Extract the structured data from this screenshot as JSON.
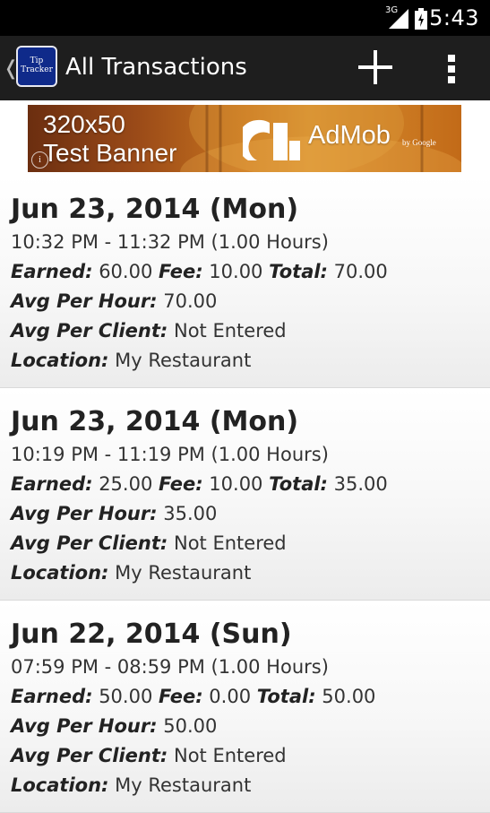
{
  "status_bar": {
    "network_label": "3G",
    "time": "5:43"
  },
  "action_bar": {
    "title": "All Transactions",
    "app_icon_text": [
      "Tip",
      "Tracker"
    ],
    "add_icon": "plus-icon",
    "overflow_icon": "overflow-menu-icon"
  },
  "ad_banner": {
    "line1": "320x50",
    "line2": "Test Banner",
    "brand": "AdMob",
    "by": "by Google"
  },
  "labels": {
    "earned": "Earned:",
    "fee": "Fee:",
    "total": "Total:",
    "avg_per_hour": "Avg Per Hour:",
    "avg_per_client": "Avg Per Client:",
    "location": "Location:"
  },
  "transactions": [
    {
      "date": "Jun 23, 2014 (Mon)",
      "time_range": "10:32 PM - 11:32 PM (1.00 Hours)",
      "earned": "60.00",
      "fee": "10.00",
      "total": "70.00",
      "avg_per_hour": "70.00",
      "avg_per_client": "Not Entered",
      "location": "My Restaurant"
    },
    {
      "date": "Jun 23, 2014 (Mon)",
      "time_range": "10:19 PM - 11:19 PM (1.00 Hours)",
      "earned": "25.00",
      "fee": "10.00",
      "total": "35.00",
      "avg_per_hour": "35.00",
      "avg_per_client": "Not Entered",
      "location": "My Restaurant"
    },
    {
      "date": "Jun 22, 2014 (Sun)",
      "time_range": "07:59 PM - 08:59 PM (1.00 Hours)",
      "earned": "50.00",
      "fee": "0.00",
      "total": "50.00",
      "avg_per_hour": "50.00",
      "avg_per_client": "Not Entered",
      "location": "My Restaurant"
    }
  ]
}
